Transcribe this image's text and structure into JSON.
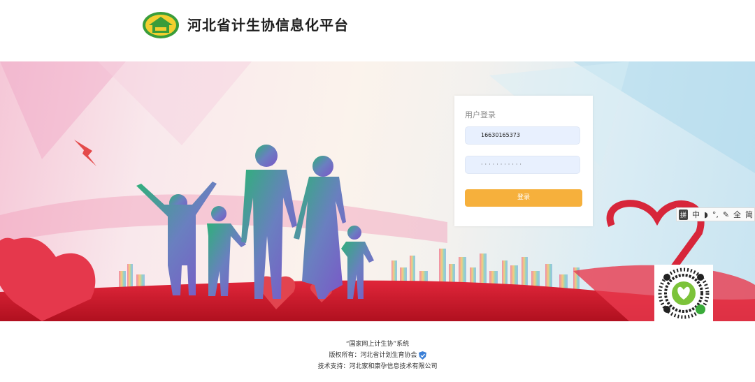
{
  "header": {
    "title": "河北省计生协信息化平台",
    "logo_icon": "house-logo-icon"
  },
  "login": {
    "title": "用户登录",
    "username_value": "16630165373",
    "password_value": "···········",
    "submit_label": "登录"
  },
  "ime_toolbar": {
    "mode_label": "拼",
    "lang_label": "中",
    "width_label": "全",
    "script_label": "简"
  },
  "footer": {
    "line1": "“国家网上计生协”系统",
    "line2": "版权所有：河北省计划生育协会",
    "line3": "技术支持：河北家和康孕信息技术有限公司"
  },
  "colors": {
    "accent": "#f6b03c",
    "logo_green": "#3a9d3a",
    "logo_yellow": "#f3cf2f",
    "input_bg": "#e8f0fe"
  }
}
